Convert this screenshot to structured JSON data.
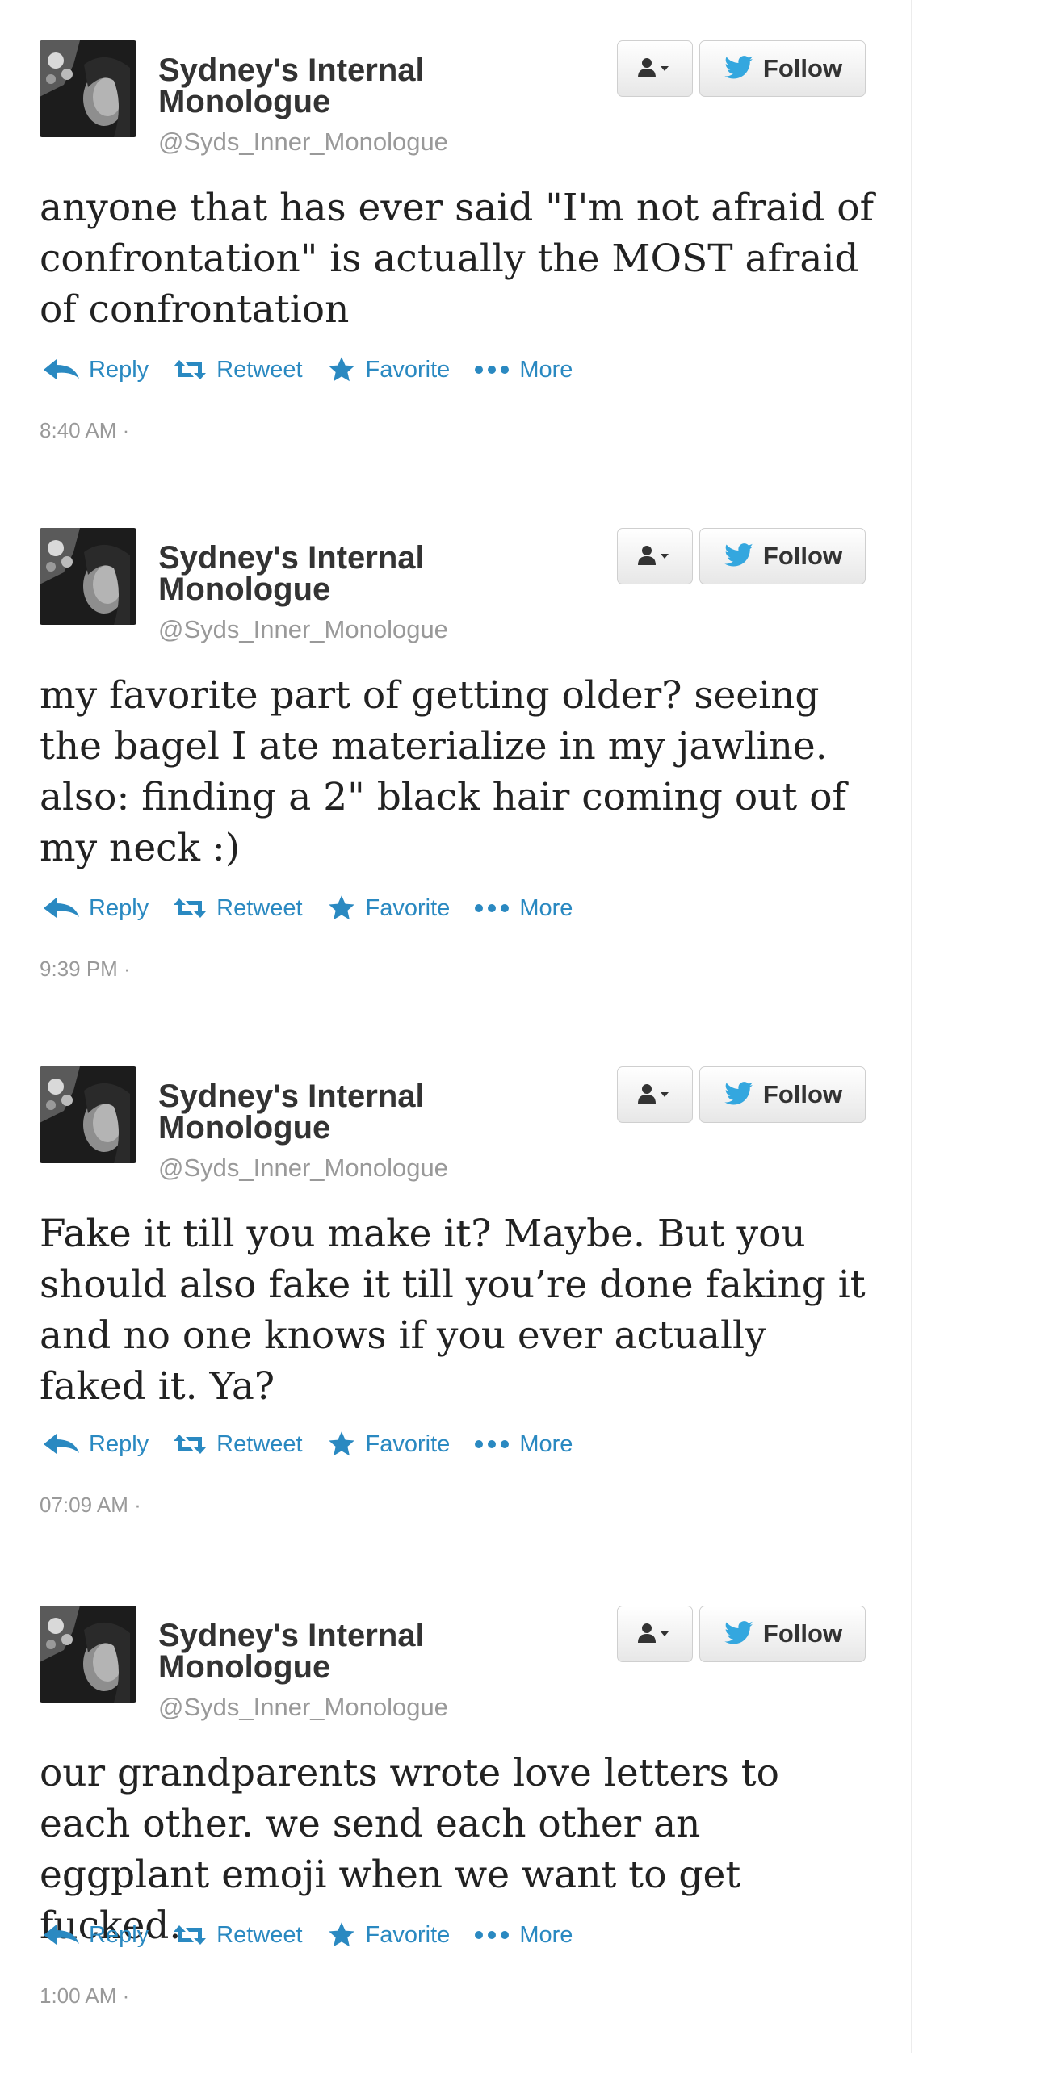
{
  "colors": {
    "link": "#2a89c1",
    "follow_bird": "#34a7df"
  },
  "tweets": [
    {
      "display_name": "Sydney's Internal Monologue",
      "handle": "@Syds_Inner_Monologue",
      "follow_label": "Follow",
      "text": "anyone that has ever said \"I'm not afraid of confrontation\" is actually the MOST afraid of confrontation",
      "actions": {
        "reply": "Reply",
        "retweet": "Retweet",
        "favorite": "Favorite",
        "more": "More"
      },
      "timestamp": "8:40 AM ·"
    },
    {
      "display_name": "Sydney's Internal Monologue",
      "handle": "@Syds_Inner_Monologue",
      "follow_label": "Follow",
      "text": "my favorite part of getting older? seeing the bagel I ate materialize in my jawline. also: finding a 2\" black hair coming out of my neck :)",
      "actions": {
        "reply": "Reply",
        "retweet": "Retweet",
        "favorite": "Favorite",
        "more": "More"
      },
      "timestamp": "9:39 PM ·"
    },
    {
      "display_name": "Sydney's Internal Monologue",
      "handle": "@Syds_Inner_Monologue",
      "follow_label": "Follow",
      "text": "Fake it till you make it? Maybe. But you should also fake it till you’re done faking it and no one knows if you ever actually faked it. Ya?",
      "actions": {
        "reply": "Reply",
        "retweet": "Retweet",
        "favorite": "Favorite",
        "more": "More"
      },
      "timestamp": "07:09 AM ·"
    },
    {
      "display_name": "Sydney's Internal Monologue",
      "handle": "@Syds_Inner_Monologue",
      "follow_label": "Follow",
      "text": "our grandparents wrote love letters to each other. we send each other an eggplant emoji when we want to get fucked.",
      "actions": {
        "reply": "Reply",
        "retweet": "Retweet",
        "favorite": "Favorite",
        "more": "More"
      },
      "timestamp": "1:00 AM ·"
    }
  ]
}
